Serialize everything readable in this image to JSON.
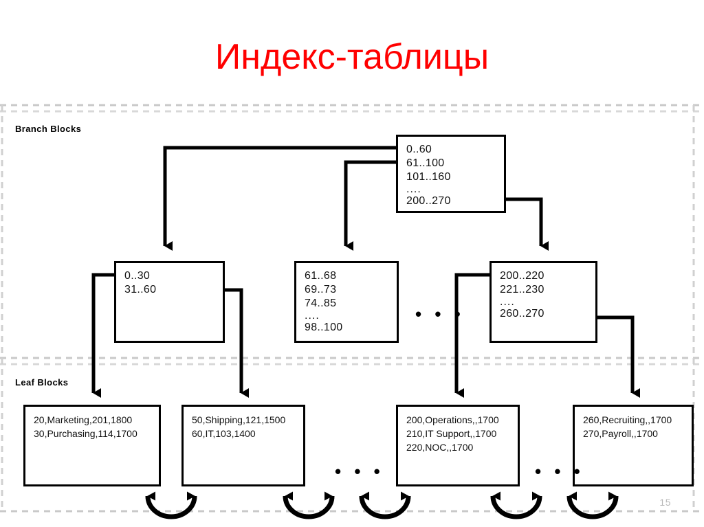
{
  "slide": {
    "title": "Индекс-таблицы",
    "title_color": "#ff0000",
    "page_number": "15",
    "background": "#ffffff"
  },
  "regions": {
    "branch_label": "Branch Blocks",
    "leaf_label": "Leaf Blocks"
  },
  "diagram": {
    "type": "b-tree-index",
    "root": {
      "id": "root-block",
      "lines": [
        "0..60",
        "61..100",
        "101..160",
        "....",
        "200..270"
      ]
    },
    "branches": [
      {
        "id": "branch-block-1",
        "lines": [
          "0..30",
          "31..60"
        ]
      },
      {
        "id": "branch-block-2",
        "lines": [
          "61..68",
          "69..73",
          "74..85",
          "....",
          "98..100"
        ]
      },
      {
        "id": "branch-block-3",
        "lines": [
          "200..220",
          "221..230",
          "....",
          "260..270"
        ]
      }
    ],
    "leaves": [
      {
        "id": "leaf-block-1",
        "lines": [
          "20,Marketing,201,1800",
          "30,Purchasing,114,1700"
        ]
      },
      {
        "id": "leaf-block-2",
        "lines": [
          "50,Shipping,121,1500",
          "60,IT,103,1400"
        ]
      },
      {
        "id": "leaf-block-3",
        "lines": [
          "200,Operations,,1700",
          "210,IT Support,,1700",
          "220,NOC,,1700"
        ]
      },
      {
        "id": "leaf-block-4",
        "lines": [
          "260,Recruiting,,1700",
          "270,Payroll,,1700"
        ]
      }
    ],
    "ellipses": {
      "branch_gap": "• • •",
      "leaf_gap_1": "• • •",
      "leaf_gap_2": "• • •"
    },
    "line_color": "#000000",
    "divider_color": "#c9c9c9"
  }
}
